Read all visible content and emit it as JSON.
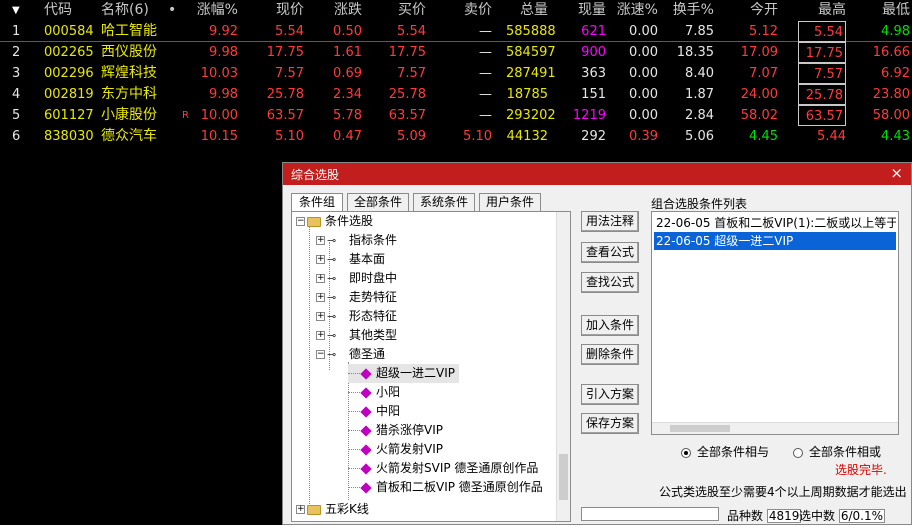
{
  "table": {
    "headers": {
      "arrow": "▼",
      "code": "代码",
      "name": "名称(6)",
      "dot": "•",
      "pct": "涨幅%",
      "price": "现价",
      "chg": "涨跌",
      "bid": "买价",
      "ask": "卖价",
      "vol": "总量",
      "cur": "现量",
      "speed": "涨速%",
      "turn": "换手%",
      "open": "今开",
      "high": "最高",
      "low": "最低"
    },
    "rows": [
      {
        "no": "1",
        "code": "000584",
        "name": "哈工智能",
        "flag": "",
        "pct": "9.92",
        "price": "5.54",
        "chg": "0.50",
        "bid": "5.54",
        "ask": "—",
        "vol": "585888",
        "cur": "621",
        "speed": "0.00",
        "turn": "7.85",
        "open": "5.12",
        "high": "5.54",
        "low": "4.98"
      },
      {
        "no": "2",
        "code": "002265",
        "name": "西仪股份",
        "flag": "",
        "pct": "9.98",
        "price": "17.75",
        "chg": "1.61",
        "bid": "17.75",
        "ask": "—",
        "vol": "584597",
        "cur": "900",
        "speed": "0.00",
        "turn": "18.35",
        "open": "17.09",
        "high": "17.75",
        "low": "16.66"
      },
      {
        "no": "3",
        "code": "002296",
        "name": "辉煌科技",
        "flag": "",
        "pct": "10.03",
        "price": "7.57",
        "chg": "0.69",
        "bid": "7.57",
        "ask": "—",
        "vol": "287491",
        "cur": "363",
        "speed": "0.00",
        "turn": "8.40",
        "open": "7.07",
        "high": "7.57",
        "low": "6.92"
      },
      {
        "no": "4",
        "code": "002819",
        "name": "东方中科",
        "flag": "",
        "pct": "9.98",
        "price": "25.78",
        "chg": "2.34",
        "bid": "25.78",
        "ask": "—",
        "vol": "18785",
        "cur": "151",
        "speed": "0.00",
        "turn": "1.87",
        "open": "24.00",
        "high": "25.78",
        "low": "23.80"
      },
      {
        "no": "5",
        "code": "601127",
        "name": "小康股份",
        "flag": "R",
        "pct": "10.00",
        "price": "63.57",
        "chg": "5.78",
        "bid": "63.57",
        "ask": "—",
        "vol": "293202",
        "cur": "1219",
        "speed": "0.00",
        "turn": "2.84",
        "open": "58.02",
        "high": "63.57",
        "low": "58.00"
      },
      {
        "no": "6",
        "code": "838030",
        "name": "德众汽车",
        "flag": "",
        "pct": "10.15",
        "price": "5.10",
        "chg": "0.47",
        "bid": "5.09",
        "ask": "5.10",
        "vol": "44132",
        "cur": "292",
        "speed": "0.39",
        "turn": "5.06",
        "open": "4.45",
        "high": "5.44",
        "low": "4.43"
      }
    ]
  },
  "dialog": {
    "title": "综合选股",
    "close": "×",
    "tabs": [
      "条件组",
      "全部条件",
      "系统条件",
      "用户条件"
    ],
    "tree": {
      "root": "条件选股",
      "groups": [
        "指标条件",
        "基本面",
        "即时盘中",
        "走势特征",
        "形态特征",
        "其他类型",
        "德圣通"
      ],
      "leaves": [
        "超级一进二VIP",
        "小阳",
        "中阳",
        "猎杀涨停VIP",
        "火箭发射VIP",
        "火箭发射SVIP 德圣通原创作品",
        "首板和二板VIP 德圣通原创作品"
      ],
      "bottom": "五彩K线"
    },
    "buttons": [
      "用法注释",
      "查看公式",
      "查找公式",
      "加入条件",
      "删除条件",
      "引入方案",
      "保存方案"
    ],
    "list_label": "组合选股条件列表",
    "list_items": [
      "22-06-05 首板和二板VIP(1):二板或以上等于",
      "22-06-05 超级一进二VIP"
    ],
    "radio_and": "全部条件相与",
    "radio_or": "全部条件相或",
    "done": "选股完毕.",
    "note": "公式类选股至少需要4个以上周期数据才能选出",
    "count_label": "品种数",
    "count_value": "4819",
    "selected_label": "选中数",
    "selected_value": "6/0.1%"
  }
}
